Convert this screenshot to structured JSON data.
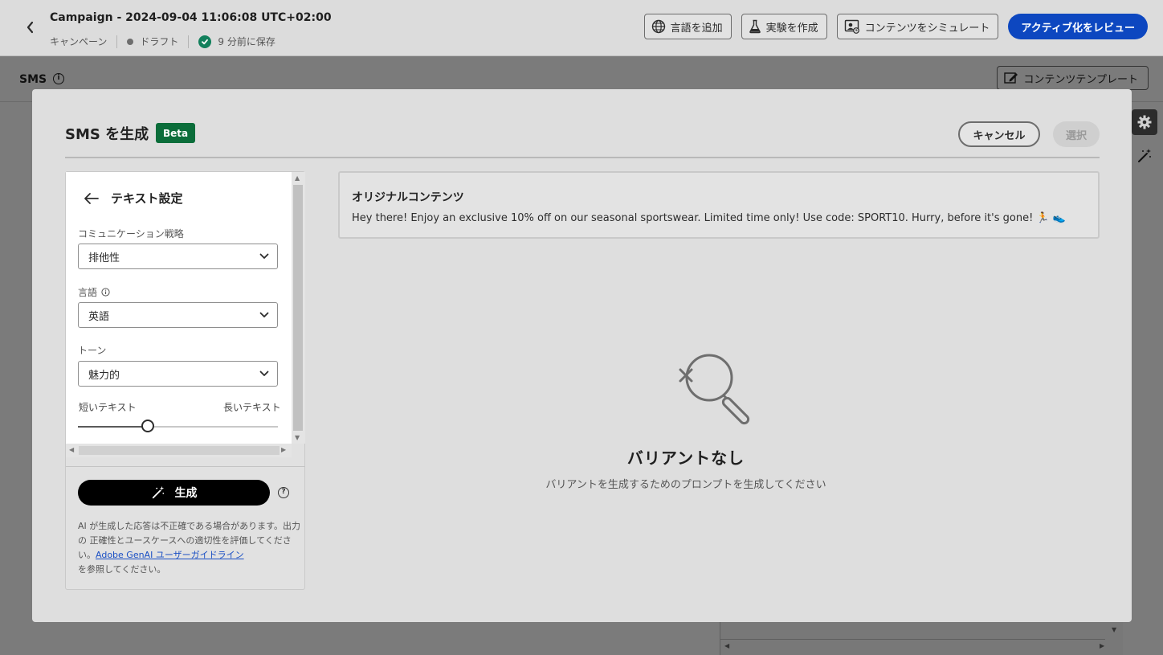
{
  "header": {
    "back_icon": "chevron-left-icon",
    "campaign_title": "Campaign - 2024-09-04 11:06:08 UTC+02:00",
    "breadcrumb_type": "キャンペーン",
    "status": "ドラフト",
    "saved_text": "9 分前に保存",
    "actions": {
      "add_language": "言語を追加",
      "create_experiment": "実験を作成",
      "simulate_content": "コンテンツをシミュレート",
      "review_activate": "アクティブ化をレビュー"
    }
  },
  "editor": {
    "channel_title": "SMS",
    "content_template_label": "コンテンツテンプレート"
  },
  "modal": {
    "title": "SMS を生成",
    "badge": "Beta",
    "cancel_label": "キャンセル",
    "select_label": "選択",
    "settings": {
      "heading": "テキスト設定",
      "strategy_label": "コミュニケーション戦略",
      "strategy_value": "排他性",
      "language_label": "言語",
      "language_value": "英語",
      "tone_label": "トーン",
      "tone_value": "魅力的",
      "length_short_label": "短いテキスト",
      "length_long_label": "長いテキスト",
      "length_slider_value": 0.35
    },
    "generate_label": "生成",
    "disclaimer_text": "AI が生成した応答は不正確である場合があります。出力の 正確性とユースケースへの適切性を評価してください。",
    "disclaimer_link": "Adobe GenAI ユーザーガイドライン",
    "disclaimer_suffix": "を参照してください。",
    "original": {
      "title": "オリジナルコンテンツ",
      "text": "Hey there! Enjoy an exclusive 10% off on our seasonal sportswear. Limited time only! Use code: SPORT10. Hurry, before it's gone! 🏃 👟"
    },
    "empty_state": {
      "title": "バリアントなし",
      "description": "バリアントを生成するためのプロンプトを生成してください"
    }
  },
  "colors": {
    "primary": "#0d47c0",
    "beta_badge": "#0b6d3a",
    "saved_check": "#12805c",
    "generate_button": "#000000"
  }
}
